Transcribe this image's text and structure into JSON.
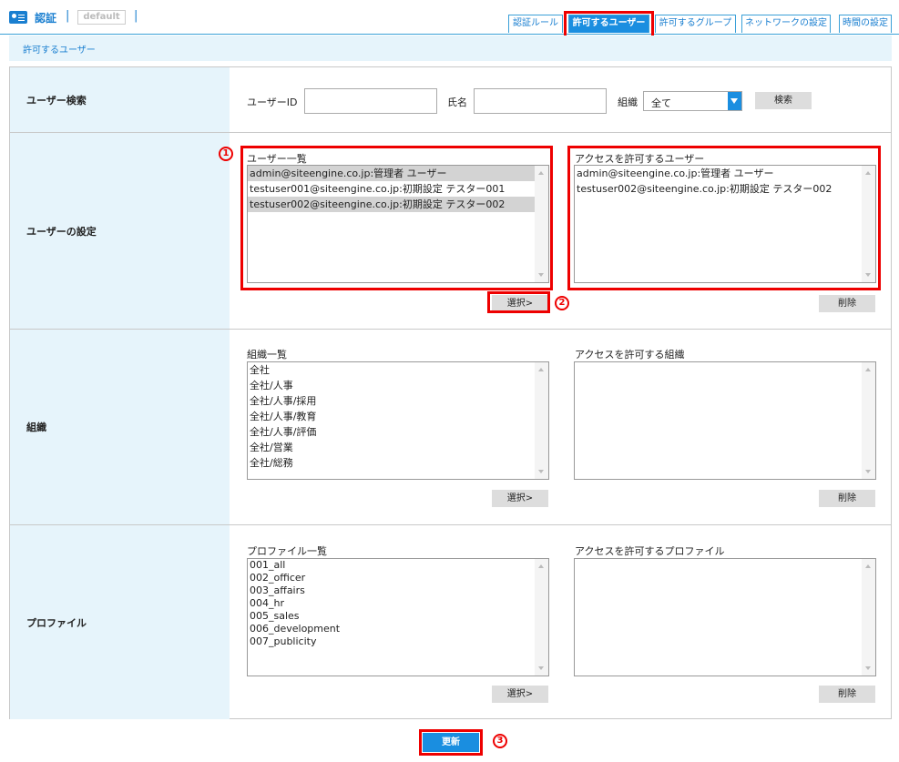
{
  "header": {
    "app_title": "認証",
    "separator": "|",
    "scope": "default",
    "tabs": [
      {
        "label": "認証ルール",
        "active": false
      },
      {
        "label": "許可するユーザー",
        "active": true
      },
      {
        "label": "許可するグループ",
        "active": false
      },
      {
        "label": "ネットワークの設定",
        "active": false
      },
      {
        "label": "時間の設定",
        "active": false
      }
    ]
  },
  "subheader": {
    "title": "許可するユーザー"
  },
  "search": {
    "section_label": "ユーザー検索",
    "userid_label": "ユーザーID",
    "userid_value": "",
    "name_label": "氏名",
    "name_value": "",
    "org_label": "組織",
    "org_value": "全て",
    "search_button": "検索"
  },
  "users": {
    "section_label": "ユーザーの設定",
    "list_title": "ユーザー一覧",
    "list_items": [
      {
        "text": "admin@siteengine.co.jp:管理者 ユーザー",
        "selected": true
      },
      {
        "text": "testuser001@siteengine.co.jp:初期設定 テスター001",
        "selected": false
      },
      {
        "text": "testuser002@siteengine.co.jp:初期設定 テスター002",
        "selected": true
      }
    ],
    "allowed_title": "アクセスを許可するユーザー",
    "allowed_items": [
      "admin@siteengine.co.jp:管理者 ユーザー",
      "testuser002@siteengine.co.jp:初期設定 テスター002"
    ],
    "select_button": "選択>",
    "delete_button": "削除"
  },
  "orgs": {
    "section_label": "組織",
    "list_title": "組織一覧",
    "list_items": [
      "全社",
      "全社/人事",
      "全社/人事/採用",
      "全社/人事/教育",
      "全社/人事/評価",
      "全社/営業",
      "全社/総務"
    ],
    "allowed_title": "アクセスを許可する組織",
    "allowed_items": [],
    "select_button": "選択>",
    "delete_button": "削除"
  },
  "profiles": {
    "section_label": "プロファイル",
    "list_title": "プロファイル一覧",
    "list_items": [
      "001_all",
      "002_officer",
      "003_affairs",
      "004_hr",
      "005_sales",
      "006_development",
      "007_publicity"
    ],
    "allowed_title": "アクセスを許可するプロファイル",
    "allowed_items": [],
    "select_button": "選択>",
    "delete_button": "削除"
  },
  "annotations": {
    "step1": "1",
    "step2": "2",
    "step3": "3",
    "highlight_color": "#e00000"
  },
  "footer": {
    "update_button": "更新"
  },
  "colors": {
    "accent": "#1a8ee0",
    "label_bg": "#e6f4fb"
  }
}
